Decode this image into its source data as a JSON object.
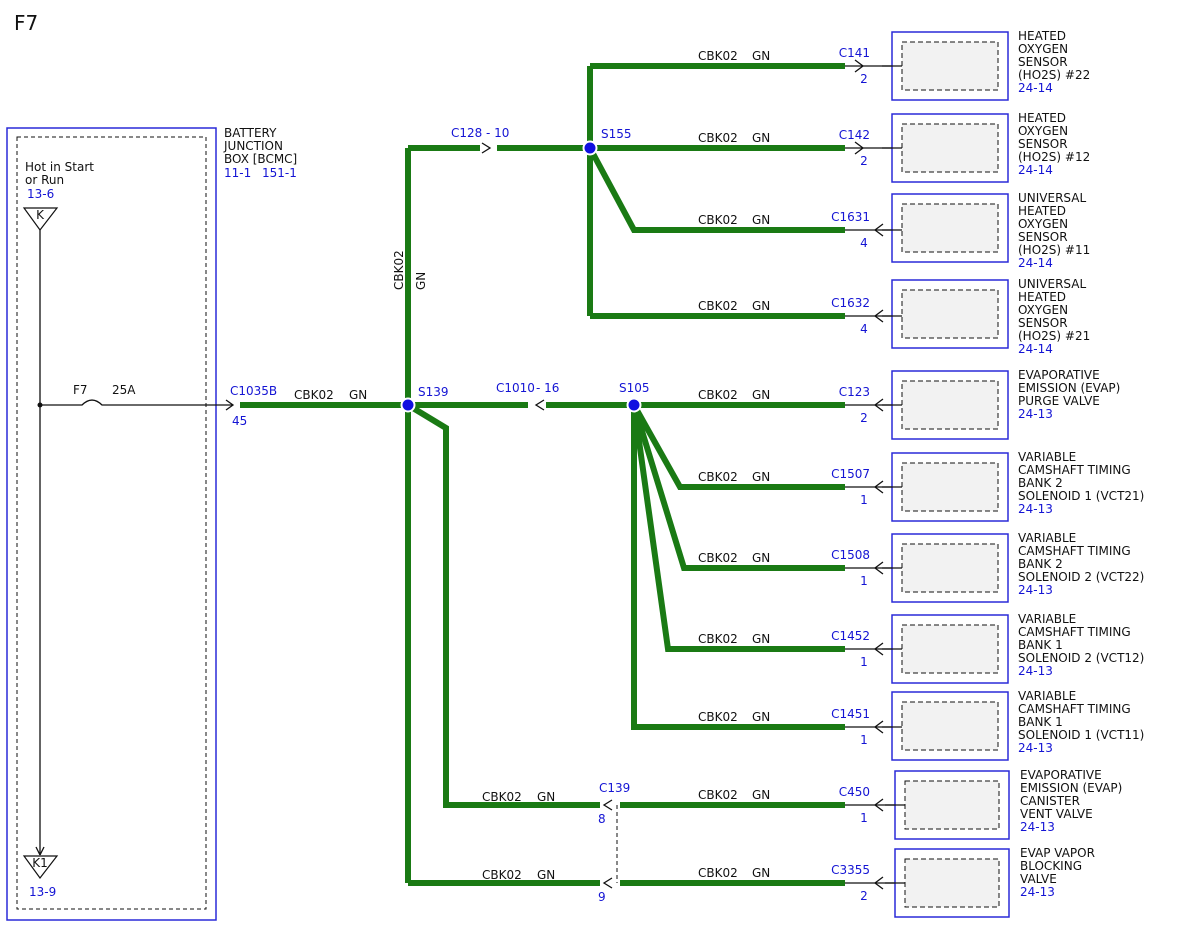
{
  "page": {
    "title": "F7"
  },
  "battery_junction_box": {
    "name_lines": [
      "BATTERY",
      "JUNCTION",
      "BOX [BCMC]"
    ],
    "refs": [
      "11-1",
      "151-1"
    ],
    "power_label_lines": [
      "Hot in Start",
      "or Run"
    ],
    "power_ref": "13-6",
    "top_pin": "K",
    "bottom_pin": "K1",
    "bottom_ref": "13-9",
    "fuse_name": "F7",
    "fuse_rating": "25A"
  },
  "connectors": {
    "c1035b": {
      "name": "C1035B",
      "pin": "45"
    },
    "c128": {
      "name": "C128",
      "pin": "- 10"
    },
    "c1010": {
      "name": "C1010",
      "pin": "- 16"
    },
    "c139": {
      "name": "C139",
      "pin_a": "8",
      "pin_b": "9"
    }
  },
  "splices": [
    "S139",
    "S155",
    "S105"
  ],
  "wire": {
    "circuit": "CBK02",
    "color": "GN"
  },
  "components": [
    {
      "connector": "C141",
      "pin": "2",
      "name_lines": [
        "HEATED",
        "OXYGEN",
        "SENSOR",
        "(HO2S) #22"
      ],
      "ref": "24-14"
    },
    {
      "connector": "C142",
      "pin": "2",
      "name_lines": [
        "HEATED",
        "OXYGEN",
        "SENSOR",
        "(HO2S) #12"
      ],
      "ref": "24-14"
    },
    {
      "connector": "C1631",
      "pin": "4",
      "name_lines": [
        "UNIVERSAL",
        "HEATED",
        "OXYGEN",
        "SENSOR",
        "(HO2S) #11"
      ],
      "ref": "24-14"
    },
    {
      "connector": "C1632",
      "pin": "4",
      "name_lines": [
        "UNIVERSAL",
        "HEATED",
        "OXYGEN",
        "SENSOR",
        "(HO2S) #21"
      ],
      "ref": "24-14"
    },
    {
      "connector": "C123",
      "pin": "2",
      "name_lines": [
        "EVAPORATIVE",
        "EMISSION (EVAP)",
        "PURGE VALVE"
      ],
      "ref": "24-13"
    },
    {
      "connector": "C1507",
      "pin": "1",
      "name_lines": [
        "VARIABLE",
        "CAMSHAFT TIMING",
        "BANK 2",
        "SOLENOID 1 (VCT21)"
      ],
      "ref": "24-13"
    },
    {
      "connector": "C1508",
      "pin": "1",
      "name_lines": [
        "VARIABLE",
        "CAMSHAFT TIMING",
        "BANK 2",
        "SOLENOID 2 (VCT22)"
      ],
      "ref": "24-13"
    },
    {
      "connector": "C1452",
      "pin": "1",
      "name_lines": [
        "VARIABLE",
        "CAMSHAFT TIMING",
        "BANK 1",
        "SOLENOID 2 (VCT12)"
      ],
      "ref": "24-13"
    },
    {
      "connector": "C1451",
      "pin": "1",
      "name_lines": [
        "VARIABLE",
        "CAMSHAFT TIMING",
        "BANK 1",
        "SOLENOID 1 (VCT11)"
      ],
      "ref": "24-13"
    },
    {
      "connector": "C450",
      "pin": "1",
      "name_lines": [
        "EVAPORATIVE",
        "EMISSION (EVAP)",
        "CANISTER",
        "VENT VALVE"
      ],
      "ref": "24-13"
    },
    {
      "connector": "C3355",
      "pin": "2",
      "name_lines": [
        "EVAP VAPOR",
        "BLOCKING",
        "VALVE"
      ],
      "ref": "24-13"
    }
  ]
}
